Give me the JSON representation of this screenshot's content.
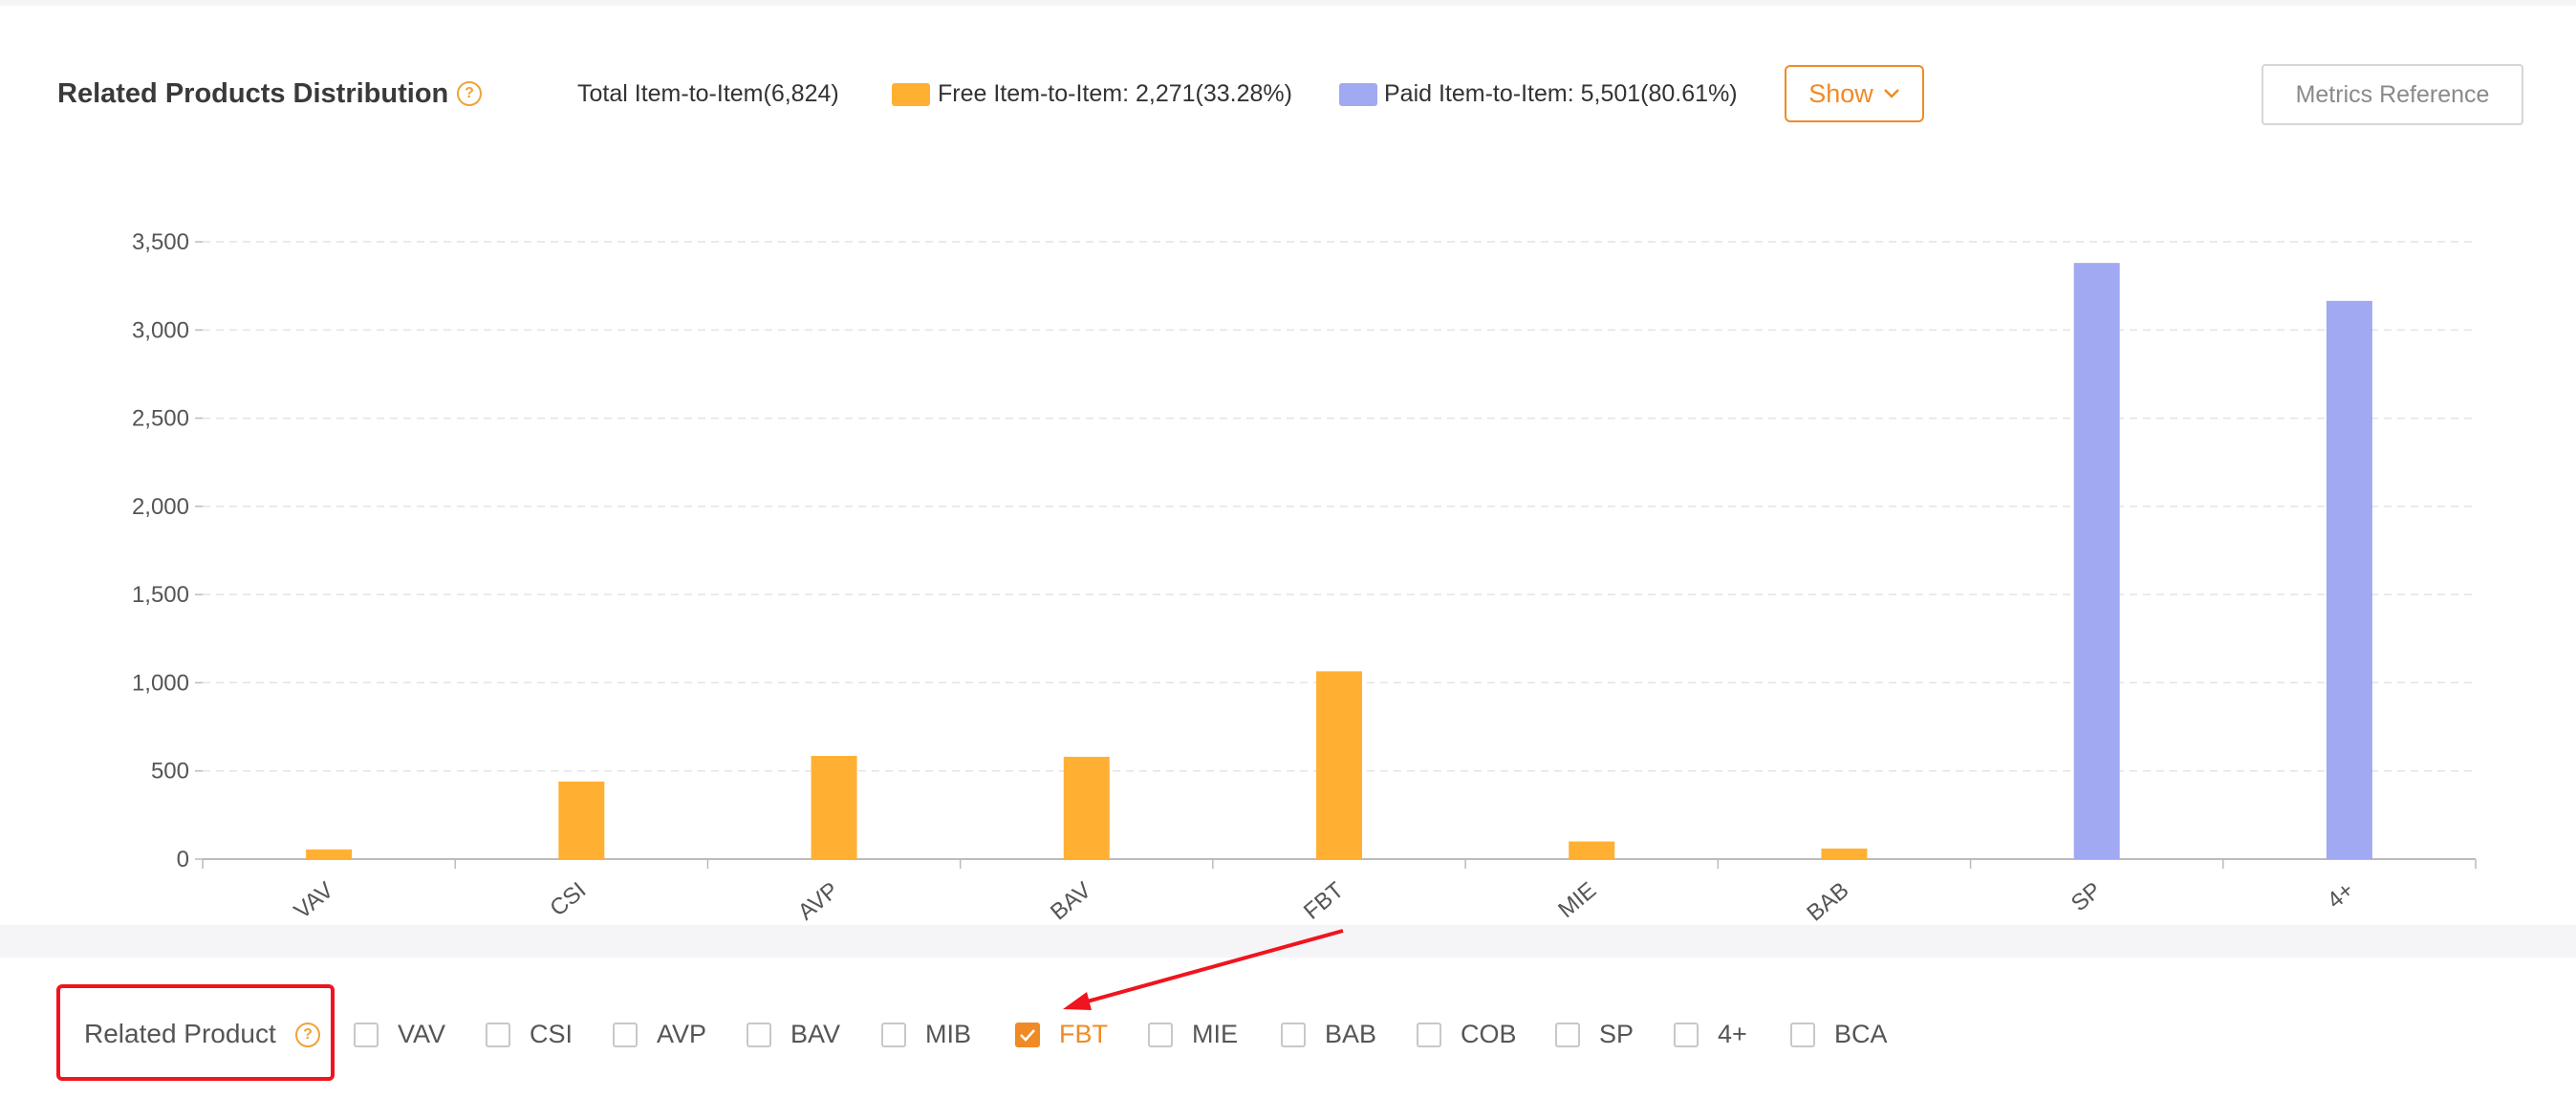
{
  "header": {
    "title": "Related Products Distribution",
    "help_icon_glyph": "?",
    "total_label": "Total Item-to-Item(6,824)",
    "free_label": "Free Item-to-Item: 2,271(33.28%)",
    "paid_label": "Paid Item-to-Item: 5,501(80.61%)",
    "show_button": "Show",
    "metrics_button": "Metrics Reference"
  },
  "colors": {
    "free": "#ffb033",
    "paid": "#a1a9f2",
    "accent": "#f08a24",
    "annotation": "#f0141e"
  },
  "chart_data": {
    "type": "bar",
    "categories": [
      "VAV",
      "CSI",
      "AVP",
      "BAV",
      "FBT",
      "MIE",
      "BAB",
      "SP",
      "4+"
    ],
    "series": [
      {
        "name": "Free Item-to-Item",
        "values": [
          55,
          440,
          585,
          580,
          1065,
          100,
          60,
          null,
          null
        ]
      },
      {
        "name": "Paid Item-to-Item",
        "values": [
          null,
          null,
          null,
          null,
          null,
          null,
          null,
          3380,
          3165
        ]
      }
    ],
    "ylim": [
      0,
      3500
    ],
    "yticks": [
      0,
      500,
      1000,
      1500,
      2000,
      2500,
      3000,
      3500
    ],
    "ytick_labels": [
      "0",
      "500",
      "1,000",
      "1,500",
      "2,000",
      "2,500",
      "3,000",
      "3,500"
    ],
    "grid": true,
    "xlabel": "",
    "ylabel": ""
  },
  "filter": {
    "label": "Related Product",
    "options": [
      {
        "label": "VAV",
        "checked": false
      },
      {
        "label": "CSI",
        "checked": false
      },
      {
        "label": "AVP",
        "checked": false
      },
      {
        "label": "BAV",
        "checked": false
      },
      {
        "label": "MIB",
        "checked": false
      },
      {
        "label": "FBT",
        "checked": true
      },
      {
        "label": "MIE",
        "checked": false
      },
      {
        "label": "BAB",
        "checked": false
      },
      {
        "label": "COB",
        "checked": false
      },
      {
        "label": "SP",
        "checked": false
      },
      {
        "label": "4+",
        "checked": false
      },
      {
        "label": "BCA",
        "checked": false
      }
    ]
  }
}
